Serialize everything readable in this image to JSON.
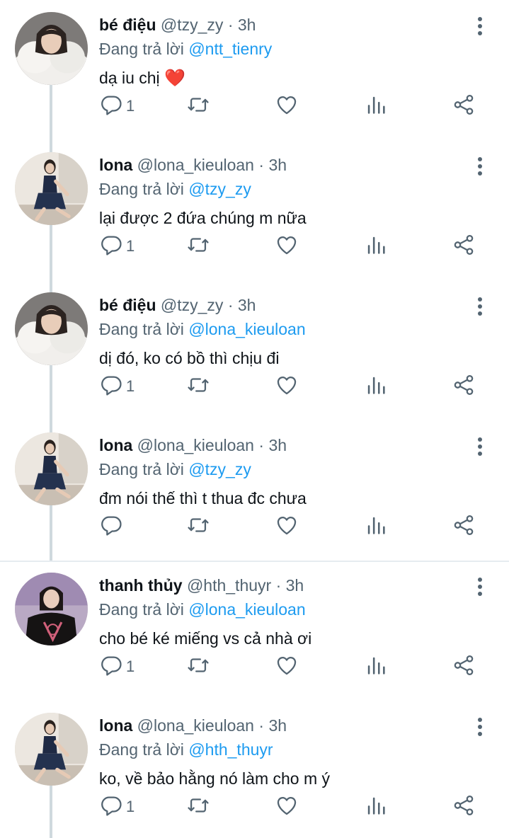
{
  "reply_prefix": "Đang trả lời",
  "separator_dot": "·",
  "colors": {
    "mention": "#1d9bf0",
    "secondary": "#536471",
    "thread_line": "#cfd9de"
  },
  "icons": {
    "reply": "reply-icon",
    "retweet": "retweet-icon",
    "like": "heart-icon",
    "stats": "stats-icon",
    "share": "share-icon",
    "more": "more-vertical-icon"
  },
  "tweets": [
    {
      "name": "bé điệu",
      "handle": "@tzy_zy",
      "time": "3h",
      "reply_to": "@ntt_tienry",
      "text": "dạ iu chị",
      "emoji": "❤️",
      "reply_count": "1",
      "avatar": "fur"
    },
    {
      "name": "lona",
      "handle": "@lona_kieuloan",
      "time": "3h",
      "reply_to": "@tzy_zy",
      "text": "lại được 2 đứa chúng m nữa",
      "emoji": "",
      "reply_count": "1",
      "avatar": "seated"
    },
    {
      "name": "bé điệu",
      "handle": "@tzy_zy",
      "time": "3h",
      "reply_to": "@lona_kieuloan",
      "text": "dị đó, ko có bồ thì chịu đi",
      "emoji": "",
      "reply_count": "1",
      "avatar": "fur"
    },
    {
      "name": "lona",
      "handle": "@lona_kieuloan",
      "time": "3h",
      "reply_to": "@tzy_zy",
      "text": "đm nói thế thì t thua đc chưa",
      "emoji": "",
      "reply_count": "",
      "avatar": "seated"
    },
    {
      "name": "thanh thủy",
      "handle": "@hth_thuyr",
      "time": "3h",
      "reply_to": "@lona_kieuloan",
      "text": "cho bé ké miếng vs cả nhà ơi",
      "emoji": "",
      "reply_count": "1",
      "avatar": "tshirt"
    },
    {
      "name": "lona",
      "handle": "@lona_kieuloan",
      "time": "3h",
      "reply_to": "@hth_thuyr",
      "text": "ko, về bảo hằng nó làm cho m ý",
      "emoji": "",
      "reply_count": "1",
      "avatar": "seated"
    }
  ]
}
